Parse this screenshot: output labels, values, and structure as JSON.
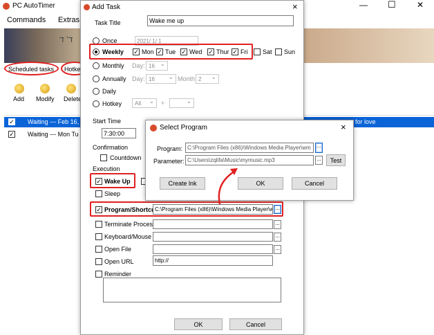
{
  "main": {
    "title": "PC AutoTimer",
    "menu": [
      "Commands",
      "Extras"
    ],
    "tabs": [
      "Scheduled tasks",
      "Hotke"
    ],
    "toolbar": [
      "Add",
      "Modify",
      "Delete"
    ],
    "rows": [
      {
        "text": "Waiting --- Feb 16,",
        "tail": "for love",
        "checked": true
      },
      {
        "text": "Waiting --- Mon Tu",
        "checked": true
      }
    ],
    "banner_text": "ד’ ד"
  },
  "add_task": {
    "title": "Add Task",
    "task_title_label": "Task Title",
    "task_title_value": "Wake me up",
    "schedule": {
      "once": "Once",
      "once_date": "2021/ 1/  1",
      "weekly": "Weekly",
      "days": [
        {
          "label": "Mon",
          "checked": true
        },
        {
          "label": "Tue",
          "checked": true
        },
        {
          "label": "Wed",
          "checked": true
        },
        {
          "label": "Thur",
          "checked": true
        },
        {
          "label": "Fri",
          "checked": true
        },
        {
          "label": "Sat",
          "checked": false
        },
        {
          "label": "Sun",
          "checked": false
        }
      ],
      "monthly": "Monthly",
      "annually": "Annually",
      "daily": "Daily",
      "hotkey": "Hotkey",
      "day_label": "Day:",
      "month_label": "Month:",
      "monthly_day": "16",
      "annual_day": "16",
      "annual_month": "2",
      "hotkey_mod": "Alt",
      "plus": "+"
    },
    "start_time_label": "Start Time",
    "start_time_value": "7:30:00",
    "confirmation_label": "Confirmation",
    "countdown_label": "Countdown",
    "execution_label": "Execution",
    "wake_up": "Wake Up",
    "sleep": "Sleep",
    "program_shortcut": "Program/Shortcut",
    "program_path": "C:\\Program Files (x86)\\Windows Media Player\\w",
    "terminate": "Terminate Process",
    "keyboard_mouse": "Keyboard/Mouse",
    "open_file": "Open File",
    "open_url": "Open URL",
    "url_value": "http://",
    "reminder": "Reminder",
    "ok": "OK",
    "cancel": "Cancel",
    "ellipsis": "..."
  },
  "select_program": {
    "title": "Select Program",
    "program_label": "Program:",
    "program_value": "C:\\Program Files (x86)\\Windows Media Player\\wm",
    "parameter_label": "Parameter:",
    "parameter_value": "C:\\Users\\zqlifa\\Music\\mymusic.mp3",
    "test": "Test",
    "create_lnk": "Create lnk",
    "ok": "OK",
    "cancel": "Cancel",
    "close": "×",
    "ellipsis": "..."
  },
  "window_controls": {
    "minimize": "—",
    "maximize": "☐",
    "close": "✕"
  },
  "colors": {
    "highlight": "#e02020",
    "selection": "#0a64d8"
  }
}
